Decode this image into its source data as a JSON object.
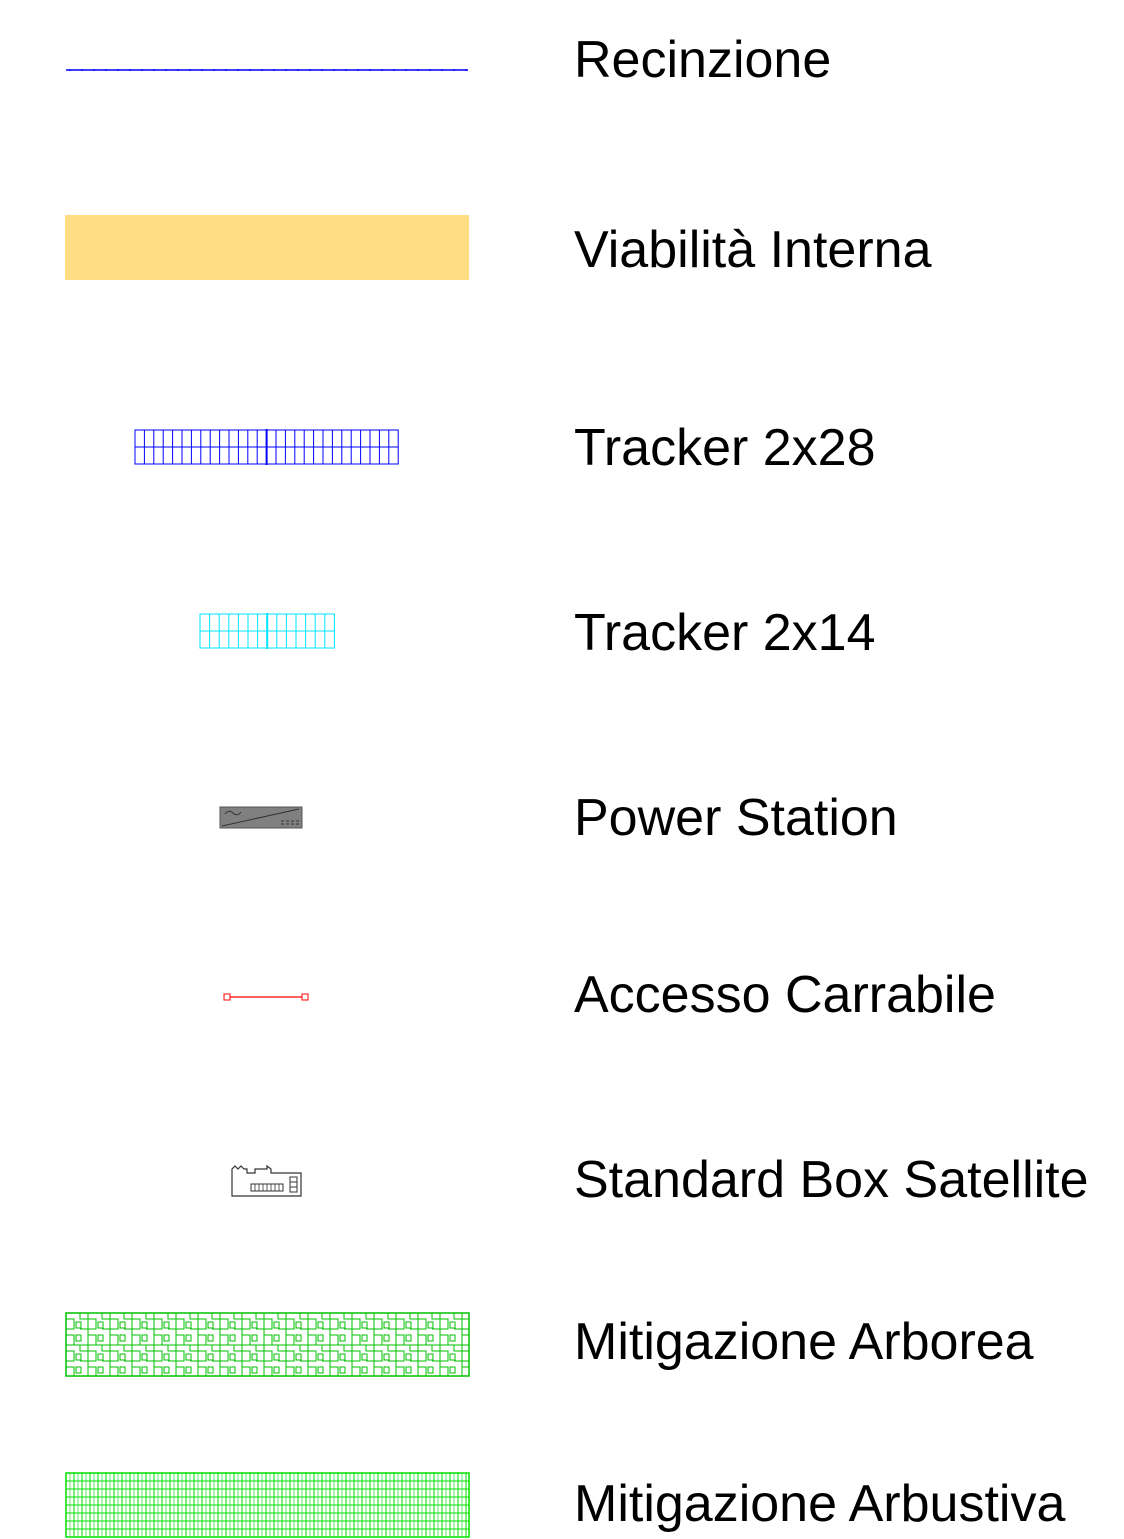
{
  "legend": {
    "items": [
      {
        "label": "Recinzione",
        "symbol": "fence-line-icon",
        "color": "#0000ff"
      },
      {
        "label": "Viabilità Interna",
        "symbol": "internal-road-swatch",
        "color": "#fedd83"
      },
      {
        "label": "Tracker 2x28",
        "symbol": "tracker-2x28-icon",
        "color": "#0000ff"
      },
      {
        "label": "Tracker 2x14",
        "symbol": "tracker-2x14-icon",
        "color": "#00ffff"
      },
      {
        "label": "Power Station",
        "symbol": "power-station-icon",
        "color": "#808080"
      },
      {
        "label": "Accesso Carrabile",
        "symbol": "vehicle-access-icon",
        "color": "#ff0000"
      },
      {
        "label": "Standard Box Satellite",
        "symbol": "satellite-box-icon",
        "color": "#000000"
      },
      {
        "label": "Mitigazione Arborea",
        "symbol": "tree-mitigation-hatch",
        "color": "#00c800"
      },
      {
        "label": "Mitigazione Arbustiva",
        "symbol": "shrub-mitigation-hatch",
        "color": "#00ff00"
      }
    ]
  }
}
